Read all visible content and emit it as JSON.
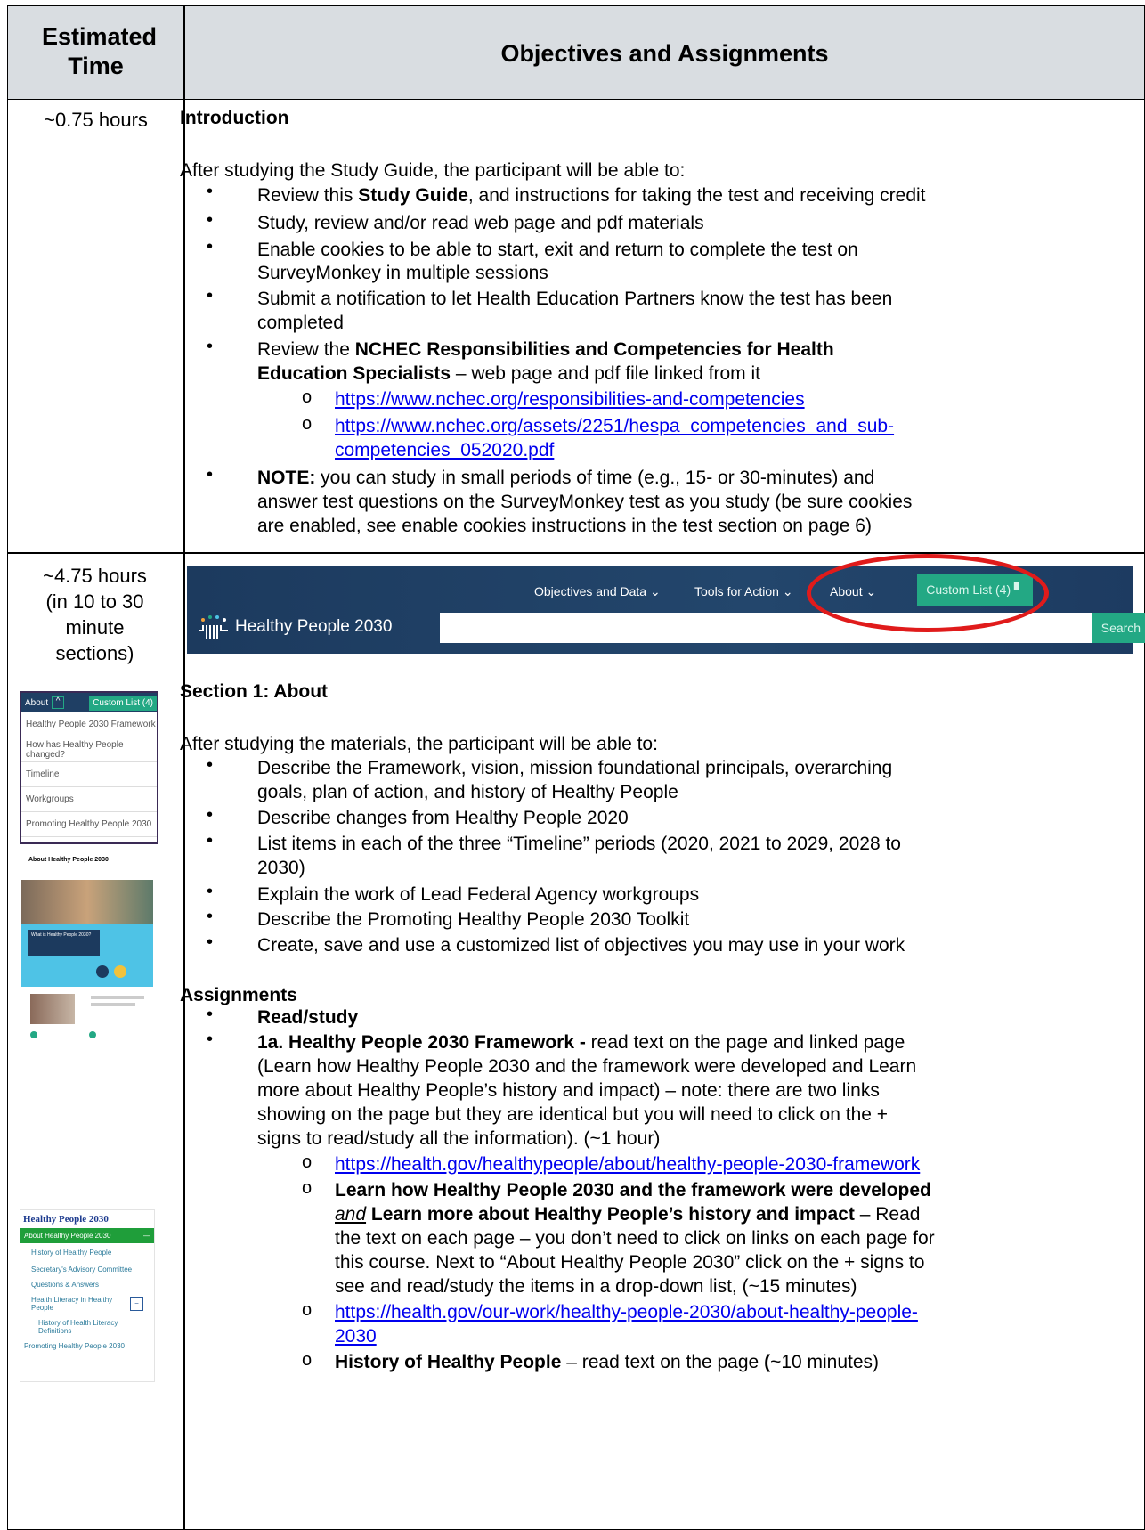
{
  "header": {
    "col1": "Estimated Time",
    "col2": "Objectives and Assignments"
  },
  "row1": {
    "time": "~0.75 hours",
    "title": "Introduction",
    "intro": "After studying the Study Guide, the participant will be able to:",
    "b1_pre": "Review this ",
    "b1_bold": "Study Guide",
    "b1_post": ", and instructions for taking the test and receiving credit",
    "b2": "Study, review and/or read web page and pdf materials",
    "b3_l1": "Enable cookies to be able to start, exit and return to complete the test on",
    "b3_l2": "SurveyMonkey in multiple sessions",
    "b4_l1": "Submit a notification to let Health Education Partners know the test has been",
    "b4_l2": "completed",
    "b5_pre": "Review the ",
    "b5_bold1": "NCHEC Responsibilities and Competencies for Health",
    "b5_bold2": "Education Specialists",
    "b5_post": " – web page and pdf file linked from it",
    "link1": "https://www.nchec.org/responsibilities-and-competencies",
    "link2_l1": "https://www.nchec.org/assets/2251/hespa_competencies_and_sub-",
    "link2_l2": "competencies_052020.pdf",
    "b6_bold": "NOTE:",
    "b6_l1": " you can study in small periods of time (e.g., 15- or 30-minutes) and",
    "b6_l2": "answer test questions on the SurveyMonkey test as you study (be sure cookies",
    "b6_l3": "are enabled, see enable cookies instructions in the test section on page 6)"
  },
  "row2": {
    "time_l1": "~4.75 hours",
    "time_l2": "(in 10 to 30",
    "time_l3": "minute",
    "time_l4": "sections)",
    "banner": {
      "logo": "Healthy People 2030",
      "nav1": "Objectives and Data",
      "nav2": "Tools for Action",
      "nav3": "About",
      "custom": "Custom List (4)",
      "search": "Search"
    },
    "thumb_menu": {
      "about": "About",
      "custom": "Custom List (4)",
      "items": [
        "Healthy People 2030 Framework",
        "How has Healthy People changed?",
        "Timeline",
        "Workgroups",
        "Promoting Healthy People 2030"
      ]
    },
    "thumb_page": {
      "title": "About Healthy People 2030",
      "box": "What is Healthy People 2030?"
    },
    "thumb_nav": {
      "title": "Healthy People 2030",
      "active": "About Healthy People 2030",
      "items": [
        "History of Healthy People",
        "Secretary's Advisory Committee",
        "Questions & Answers",
        "Health Literacy in Healthy People",
        "History of Health Literacy Definitions",
        "Promoting Healthy People 2030"
      ]
    },
    "section_title": "Section 1: About",
    "intro": "After studying the materials, the participant will be able to:",
    "o1_l1": "Describe the Framework, vision, mission foundational principals, overarching",
    "o1_l2": "goals, plan of action, and history of Healthy People",
    "o2": "Describe changes from Healthy People 2020",
    "o3_l1": "List items in each of the three “Timeline” periods (2020, 2021 to 2029, 2028 to",
    "o3_l2": "2030)",
    "o4": "Explain the work of Lead Federal Agency workgroups",
    "o5": "Describe the Promoting Healthy People 2030 Toolkit",
    "o6": "Create, save and use a customized list of objectives you may use in your work",
    "assignments": "Assignments",
    "a1": "Read/study",
    "a2_bold": "1a. Healthy People 2030 Framework -",
    "a2_l1": " read text on the page and linked page",
    "a2_l2": "(Learn how Healthy People 2030 and the framework were developed and Learn",
    "a2_l3": "more about Healthy People’s history and impact) – note: there are two links",
    "a2_l4": "showing on the page but they are identical but you will need to click on the +",
    "a2_l5": "signs to read/study all the information). (~1 hour)",
    "s1_link": "https://health.gov/healthypeople/about/healthy-people-2030-framework",
    "s2_bold1": "Learn how Healthy People 2030 and the framework were developed",
    "s2_and": "and",
    "s2_bold2": " Learn more about Healthy People’s history and impact",
    "s2_post": " – Read",
    "s2_l3": "the text on each page – you don’t need to click on links on each page for",
    "s2_l4": "this course. Next to “About Healthy People 2030” click on the + signs to",
    "s2_l5": "see and read/study the items in a drop-down list, (~15 minutes)",
    "s3_link_l1": "https://health.gov/our-work/healthy-people-2030/about-healthy-people-",
    "s3_link_l2": "2030",
    "s4_bold": "History of Healthy People",
    "s4_mid": " – read text on the page ",
    "s4_paren": "(",
    "s4_end": "~10 minutes)"
  },
  "colors": {
    "header_bg": "#d9dde1",
    "link": "#0000ee",
    "banner": "#1f3f64",
    "accent": "#23a884",
    "highlight_ring": "#e01b1b"
  }
}
